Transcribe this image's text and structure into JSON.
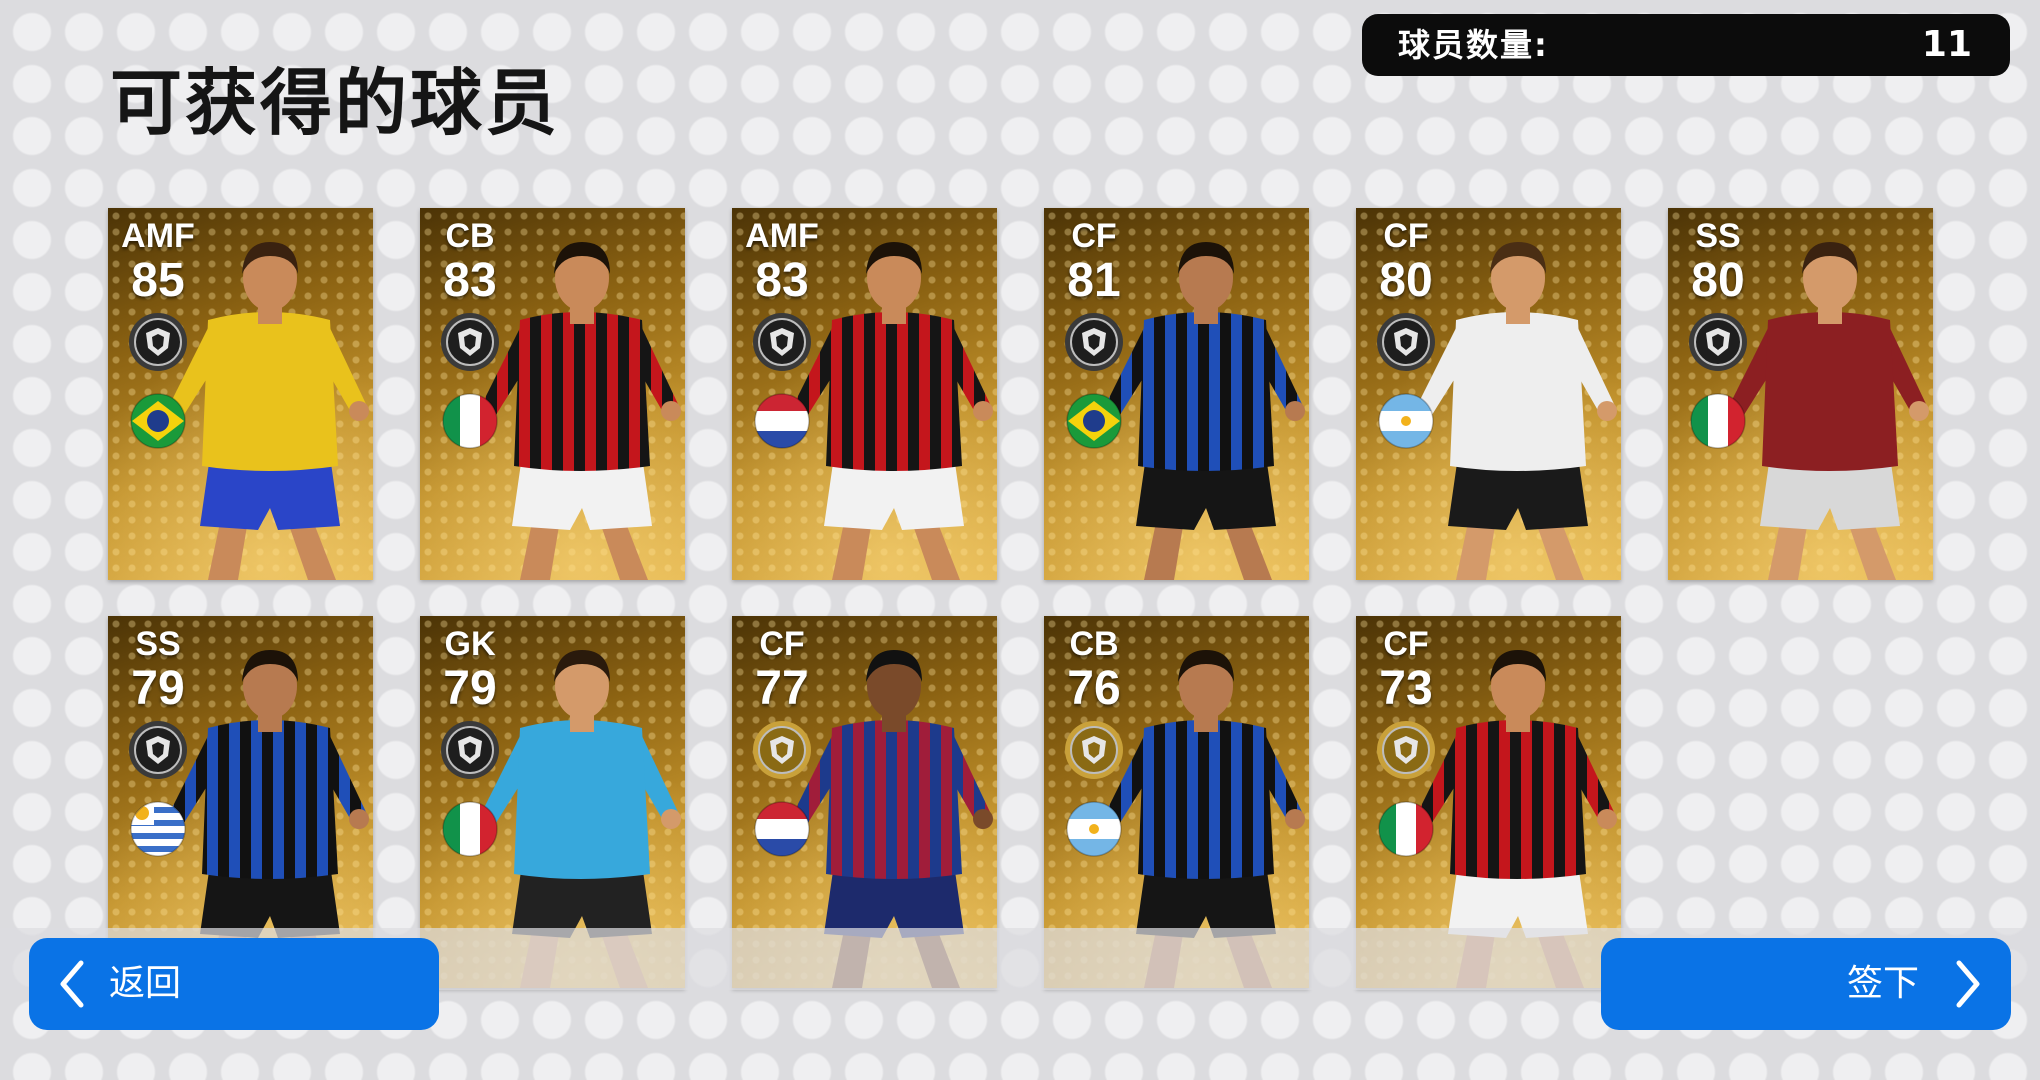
{
  "page": {
    "title": "可获得的球员",
    "player_count_label": "球员数量:",
    "player_count": "11"
  },
  "players": [
    {
      "position": "AMF",
      "rating": "85",
      "flag": "brazil",
      "badge": "silver",
      "kit": "yellow-blue"
    },
    {
      "position": "CB",
      "rating": "83",
      "flag": "italy",
      "badge": "silver",
      "kit": "red-black-stripes"
    },
    {
      "position": "AMF",
      "rating": "83",
      "flag": "netherlands",
      "badge": "silver",
      "kit": "red-black-stripes"
    },
    {
      "position": "CF",
      "rating": "81",
      "flag": "brazil",
      "badge": "silver",
      "kit": "blue-black-stripes"
    },
    {
      "position": "CF",
      "rating": "80",
      "flag": "argentina",
      "badge": "silver",
      "kit": "white-black"
    },
    {
      "position": "SS",
      "rating": "80",
      "flag": "italy",
      "badge": "silver",
      "kit": "maroon"
    },
    {
      "position": "SS",
      "rating": "79",
      "flag": "uruguay",
      "badge": "silver",
      "kit": "blue-black-stripes"
    },
    {
      "position": "GK",
      "rating": "79",
      "flag": "italy",
      "badge": "silver",
      "kit": "sky-blue"
    },
    {
      "position": "CF",
      "rating": "77",
      "flag": "netherlands",
      "badge": "gold",
      "kit": "blue-red-stripes"
    },
    {
      "position": "CB",
      "rating": "76",
      "flag": "argentina",
      "badge": "gold",
      "kit": "blue-black-stripes"
    },
    {
      "position": "CF",
      "rating": "73",
      "flag": "italy",
      "badge": "gold",
      "kit": "red-black-stripes"
    }
  ],
  "buttons": {
    "back": "返回",
    "sign": "签下"
  },
  "colors": {
    "button_blue": "#0a73e6",
    "card_gold": "#c0902a",
    "count_bar": "#0c0c0c"
  },
  "icons": {
    "back": "chevron-left-icon",
    "sign": "chevron-right-icon"
  }
}
